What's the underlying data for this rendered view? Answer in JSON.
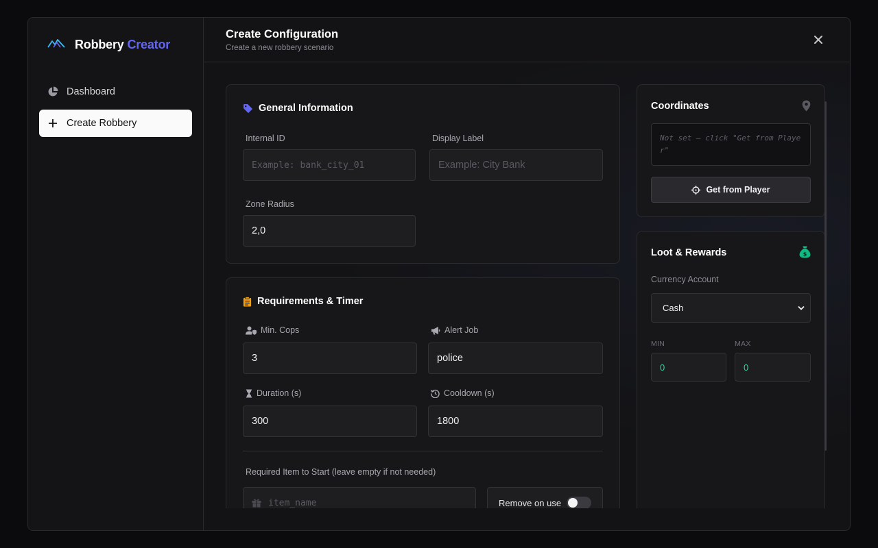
{
  "brand": {
    "name": "Robbery",
    "accent_word": "Creator",
    "accent_color": "#6366f1",
    "logo_icon": "mountain-icon"
  },
  "sidebar": {
    "items": [
      {
        "label": "Dashboard",
        "icon": "pie-chart-icon",
        "active": false
      },
      {
        "label": "Create Robbery",
        "icon": "plus-icon",
        "active": true
      }
    ]
  },
  "header": {
    "title": "Create Configuration",
    "subtitle": "Create a new robbery scenario"
  },
  "general": {
    "title": "General Information",
    "internal_id": {
      "label": "Internal ID",
      "placeholder": "Example: bank_city_01",
      "value": ""
    },
    "display_label": {
      "label": "Display Label",
      "placeholder": "Example: City Bank",
      "value": ""
    },
    "zone_radius": {
      "label": "Zone Radius",
      "value": "2,0"
    }
  },
  "requirements": {
    "title": "Requirements & Timer",
    "min_cops": {
      "label": "Min. Cops",
      "value": "3"
    },
    "alert_job": {
      "label": "Alert Job",
      "value": "police"
    },
    "duration": {
      "label": "Duration (s)",
      "value": "300"
    },
    "cooldown": {
      "label": "Cooldown (s)",
      "value": "1800"
    },
    "required_item": {
      "label": "Required Item to Start (leave empty if not needed)",
      "placeholder": "item_name",
      "value": ""
    },
    "remove_on_use": {
      "label": "Remove on use",
      "enabled": false
    }
  },
  "coordinates": {
    "title": "Coordinates",
    "value_text": "Not set — click \"Get from Player\"",
    "button_label": "Get from Player"
  },
  "loot": {
    "title": "Loot & Rewards",
    "currency_label": "Currency Account",
    "currency_value": "Cash",
    "min_label": "MIN",
    "max_label": "MAX",
    "min_value": "0",
    "max_value": "0"
  },
  "colors": {
    "accent": "#6366f1",
    "warning": "#f59e0b",
    "success": "#34d399"
  }
}
